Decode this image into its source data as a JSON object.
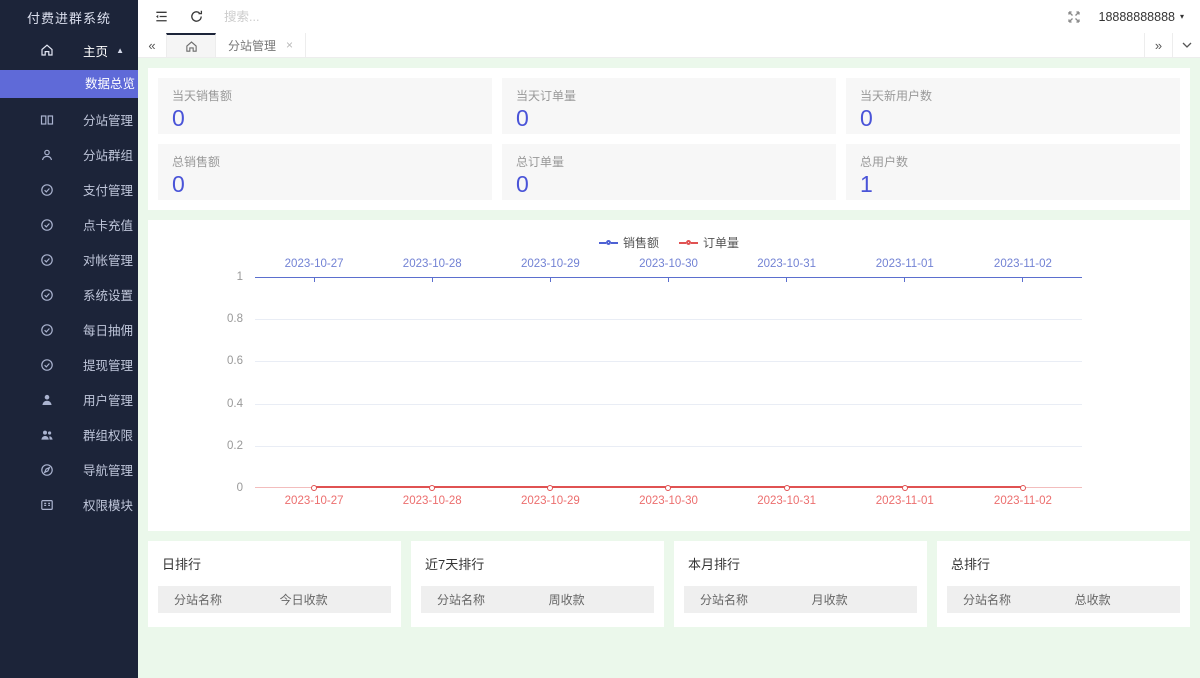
{
  "sidebar": {
    "title": "付费进群系统",
    "home": {
      "label": "主页"
    },
    "active_item": {
      "label": "数据总览"
    },
    "items": [
      {
        "label": "分站管理",
        "icon": "columns-icon"
      },
      {
        "label": "分站群组",
        "icon": "group-icon"
      },
      {
        "label": "支付管理",
        "icon": "shield-check-icon"
      },
      {
        "label": "点卡充值",
        "icon": "shield-check-icon"
      },
      {
        "label": "对帐管理",
        "icon": "shield-check-icon"
      },
      {
        "label": "系统设置",
        "icon": "shield-check-icon"
      },
      {
        "label": "每日抽佣",
        "icon": "shield-check-icon"
      },
      {
        "label": "提现管理",
        "icon": "shield-check-icon"
      },
      {
        "label": "用户管理",
        "icon": "user-icon"
      },
      {
        "label": "群组权限",
        "icon": "users-icon"
      },
      {
        "label": "导航管理",
        "icon": "compass-icon"
      },
      {
        "label": "权限模块",
        "icon": "modules-icon"
      }
    ]
  },
  "header": {
    "search_placeholder": "搜索...",
    "user_phone": "18888888888"
  },
  "tabbar": {
    "tab_label": "分站管理"
  },
  "stats": {
    "cards": [
      {
        "label": "当天销售额",
        "value": "0"
      },
      {
        "label": "当天订单量",
        "value": "0"
      },
      {
        "label": "当天新用户数",
        "value": "0"
      },
      {
        "label": "总销售额",
        "value": "0"
      },
      {
        "label": "总订单量",
        "value": "0"
      },
      {
        "label": "总用户数",
        "value": "1"
      }
    ]
  },
  "chart_data": {
    "type": "line",
    "x": [
      "2023-10-27",
      "2023-10-28",
      "2023-10-29",
      "2023-10-30",
      "2023-10-31",
      "2023-11-01",
      "2023-11-02"
    ],
    "series": [
      {
        "name": "销售额",
        "color": "#4d61d4",
        "values": [
          0,
          0,
          0,
          0,
          0,
          0,
          0
        ]
      },
      {
        "name": "订单量",
        "color": "#e05252",
        "values": [
          0,
          0,
          0,
          0,
          0,
          0,
          0
        ]
      }
    ],
    "title": "",
    "xlabel": "",
    "ylabel": "",
    "ylim": [
      0,
      1
    ],
    "yticks": [
      "1",
      "0.8",
      "0.6",
      "0.4",
      "0.2",
      "0"
    ],
    "grid": true,
    "legend_position": "top-center"
  },
  "rankings": [
    {
      "title": "日排行",
      "columns": [
        "分站名称",
        "今日收款"
      ]
    },
    {
      "title": "近7天排行",
      "columns": [
        "分站名称",
        "周收款"
      ]
    },
    {
      "title": "本月排行",
      "columns": [
        "分站名称",
        "月收款"
      ]
    },
    {
      "title": "总排行",
      "columns": [
        "分站名称",
        "总收款"
      ]
    }
  ],
  "colors": {
    "sidebar_bg": "#1c2439",
    "accent_purple": "#5f6ad8",
    "content_bg": "#ebf8eb",
    "stat_value_blue": "#4a54d8",
    "series_blue": "#4d61d4",
    "series_red": "#e05252"
  }
}
